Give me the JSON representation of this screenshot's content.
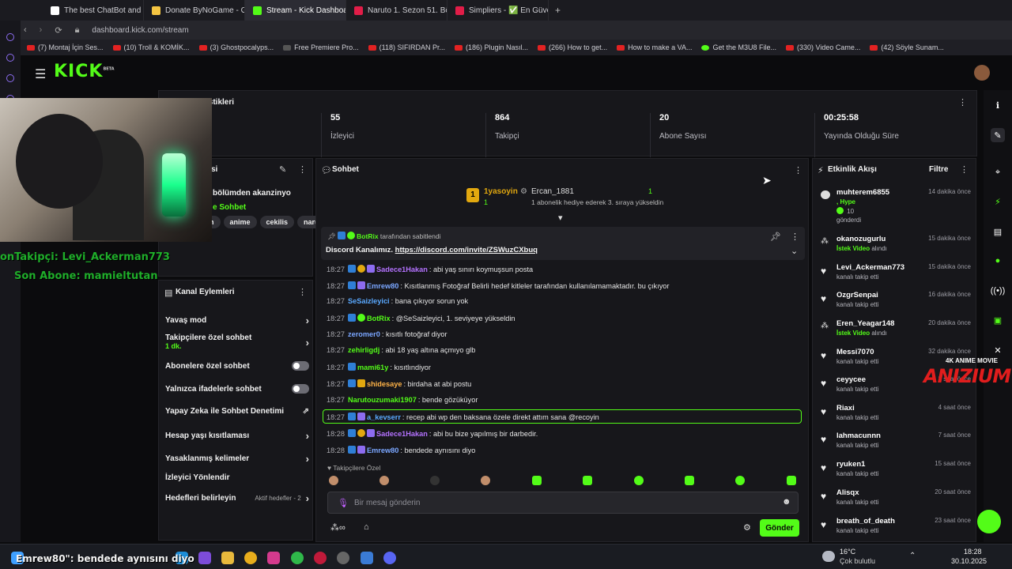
{
  "browser": {
    "tabs": [
      {
        "label": "The best ChatBot and Wi",
        "color": "#ffffff"
      },
      {
        "label": "Donate ByNoGame - Gelir",
        "color": "#f5c542"
      },
      {
        "label": "Stream - Kick Dashboard",
        "color": "#53fc18"
      },
      {
        "label": "Naruto 1. Sezon 51. Bölüm",
        "color": "#e11d48"
      },
      {
        "label": "Simpliers - ✅ En Güvenil",
        "color": "#e11d48"
      }
    ],
    "url": "dashboard.kick.com/stream",
    "bookmarks": [
      "(7) Montaj İçin Ses...",
      "(10) Troll & KOMİK...",
      "(3) Ghostpocalyps...",
      "Free Premiere Pro...",
      "(118) SIFIRDAN Pr...",
      "(186) Plugin Nasıl...",
      "(266) How to get...",
      "How to make a VA...",
      "Get the M3U8 File...",
      "(330) Video Came...",
      "(42) Söyle Sunam..."
    ]
  },
  "kick": {
    "logo": "KICK",
    "logo_beta": "BETA"
  },
  "stats": {
    "title": "istikleri",
    "items": [
      {
        "value": "55",
        "label": "İzleyici"
      },
      {
        "value": "864",
        "label": "Takipçi"
      },
      {
        "value": "20",
        "label": "Abone Sayısı"
      },
      {
        "value": "00:25:58",
        "label": "Yayında Olduğu Süre"
      }
    ]
  },
  "overlay": {
    "follower": "onTakipçi: Levi_Ackerman773",
    "subscriber": "Son Abone: mamieltutan",
    "bottom_chat": "Emrew80\": bendede aynısını diyo"
  },
  "info_panel": {
    "title_fragment": "si",
    "stream_title": "bölümden akanzinyo",
    "category": "e Sohbet",
    "tags": [
      "h",
      "anime",
      "cekilis",
      "naru"
    ]
  },
  "actions": {
    "title": "Kanal Eylemleri",
    "items": [
      {
        "label": "Yavaş mod",
        "control": "chevron"
      },
      {
        "label": "Takipçilere özel sohbet",
        "sub": "1 dk.",
        "control": "chevron"
      },
      {
        "label": "Abonelere özel sohbet",
        "control": "toggle"
      },
      {
        "label": "Yalnızca ifadelerle sohbet",
        "control": "toggle"
      },
      {
        "label": "Yapay Zeka ile Sohbet Denetimi",
        "control": "chart"
      },
      {
        "label": "Hesap yaşı kısıtlaması",
        "control": "chevron"
      },
      {
        "label": "Yasaklanmış kelimeler",
        "control": "chevron"
      },
      {
        "label": "İzleyici Yönlendir",
        "control": "none"
      },
      {
        "label": "Hedefleri belirleyin",
        "extra": "Aktif hedefler - 2",
        "control": "chevron"
      }
    ]
  },
  "chat": {
    "title": "Sohbet",
    "leader1": {
      "rank": "1",
      "name": "1yasoyin",
      "count": "1"
    },
    "leader2": {
      "name": "Ercan_1881",
      "count": "1",
      "note": "1 abonelik hediye ederek 3. sıraya yükseldin"
    },
    "pinned_by": "BotRix",
    "pinned_suffix": "tarafından sabitlendi",
    "pinned_text": "Discord Kanalımız. ",
    "pinned_link": "https://discord.com/invite/ZSWuzCXbuq",
    "messages": [
      {
        "time": "18:27",
        "user": "Sadece1Hakan",
        "color": "#b472ff",
        "text": "abi yaş sınırı koymuşsun posta"
      },
      {
        "time": "18:27",
        "user": "Emrew80",
        "color": "#7aa6ff",
        "text": "Kısıtlanmış Fotoğraf Belirli hedef kitleler tarafından kullanılamamaktadır. bu çıkıyor"
      },
      {
        "time": "18:27",
        "user": "SeSaizleyici",
        "color": "#5aa9ff",
        "text": "bana çıkıyor sorun yok"
      },
      {
        "time": "18:27",
        "user": "BotRix",
        "color": "#53fc18",
        "text": "@SeSaizleyici, 1. seviyeye yükseldin"
      },
      {
        "time": "18:27",
        "user": "zeromer0",
        "color": "#7aa6ff",
        "text": "kısıtlı fotoğraf diyor"
      },
      {
        "time": "18:27",
        "user": "zehirligdj",
        "color": "#53fc18",
        "text": "abi 18 yaş altına açmıyo glb"
      },
      {
        "time": "18:27",
        "user": "mami61y",
        "color": "#53fc18",
        "text": "kısıtlındiyor"
      },
      {
        "time": "18:27",
        "user": "shidesaye",
        "color": "#ffb347",
        "text": "birdaha at abi postu"
      },
      {
        "time": "18:27",
        "user": "Narutouzumaki1907",
        "color": "#53fc18",
        "text": "bende gözüküyor"
      },
      {
        "time": "18:27",
        "user": "a_kevserr",
        "color": "#5aa9ff",
        "text": "recep abi wp den baksana özele direkt attım sana @recoyin"
      },
      {
        "time": "18:28",
        "user": "Sadece1Hakan",
        "color": "#b472ff",
        "text": "abi bu bize yapılmış bir darbedir."
      },
      {
        "time": "18:28",
        "user": "Emrew80",
        "color": "#7aa6ff",
        "text": "bendede aynısını diyo"
      }
    ],
    "follower_only": "Takipçilere Özel",
    "placeholder": "Bir mesaj gönderin",
    "send": "Gönder"
  },
  "activity": {
    "title": "Etkinlik Akışı",
    "filter": "Filtre",
    "events": [
      {
        "name": "muhterem6855",
        "sub": ", Hype",
        "sub2": "10",
        "sub3": "gönderdi",
        "time": "14 dakika önce",
        "type": "gift"
      },
      {
        "name": "okanozugurlu",
        "sub": "İstek Video alındı",
        "time": "15 dakika önce",
        "type": "request"
      },
      {
        "name": "Levi_Ackerman773",
        "sub": "kanalı takip etti",
        "time": "15 dakika önce",
        "type": "follow"
      },
      {
        "name": "OzgrSenpai",
        "sub": "kanalı takip etti",
        "time": "16 dakika önce",
        "type": "follow"
      },
      {
        "name": "Eren_Yeagar148",
        "sub": "İstek Video alındı",
        "time": "20 dakika önce",
        "type": "request"
      },
      {
        "name": "Messi7070",
        "sub": "kanalı takip etti",
        "time": "32 dakika önce",
        "type": "follow"
      },
      {
        "name": "ceyycee",
        "sub": "kanalı takip etti",
        "time": "3 saat önce",
        "type": "follow"
      },
      {
        "name": "Riaxi",
        "sub": "kanalı takip etti",
        "time": "4 saat önce",
        "type": "follow"
      },
      {
        "name": "lahmacunnn",
        "sub": "kanalı takip etti",
        "time": "7 saat önce",
        "type": "follow"
      },
      {
        "name": "ryuken1",
        "sub": "kanalı takip etti",
        "time": "15 saat önce",
        "type": "follow"
      },
      {
        "name": "Alisqx",
        "sub": "kanalı takip etti",
        "time": "20 saat önce",
        "type": "follow"
      },
      {
        "name": "breath_of_death",
        "sub": "kanalı takip etti",
        "time": "23 saat önce",
        "type": "follow"
      }
    ]
  },
  "watermark": {
    "top": "4K ANIME MOVIE",
    "main": "ANIZIUM"
  },
  "taskbar": {
    "weather_temp": "16°C",
    "weather_desc": "Çok bulutlu",
    "time": "18:28",
    "date": "30.10.2025"
  }
}
